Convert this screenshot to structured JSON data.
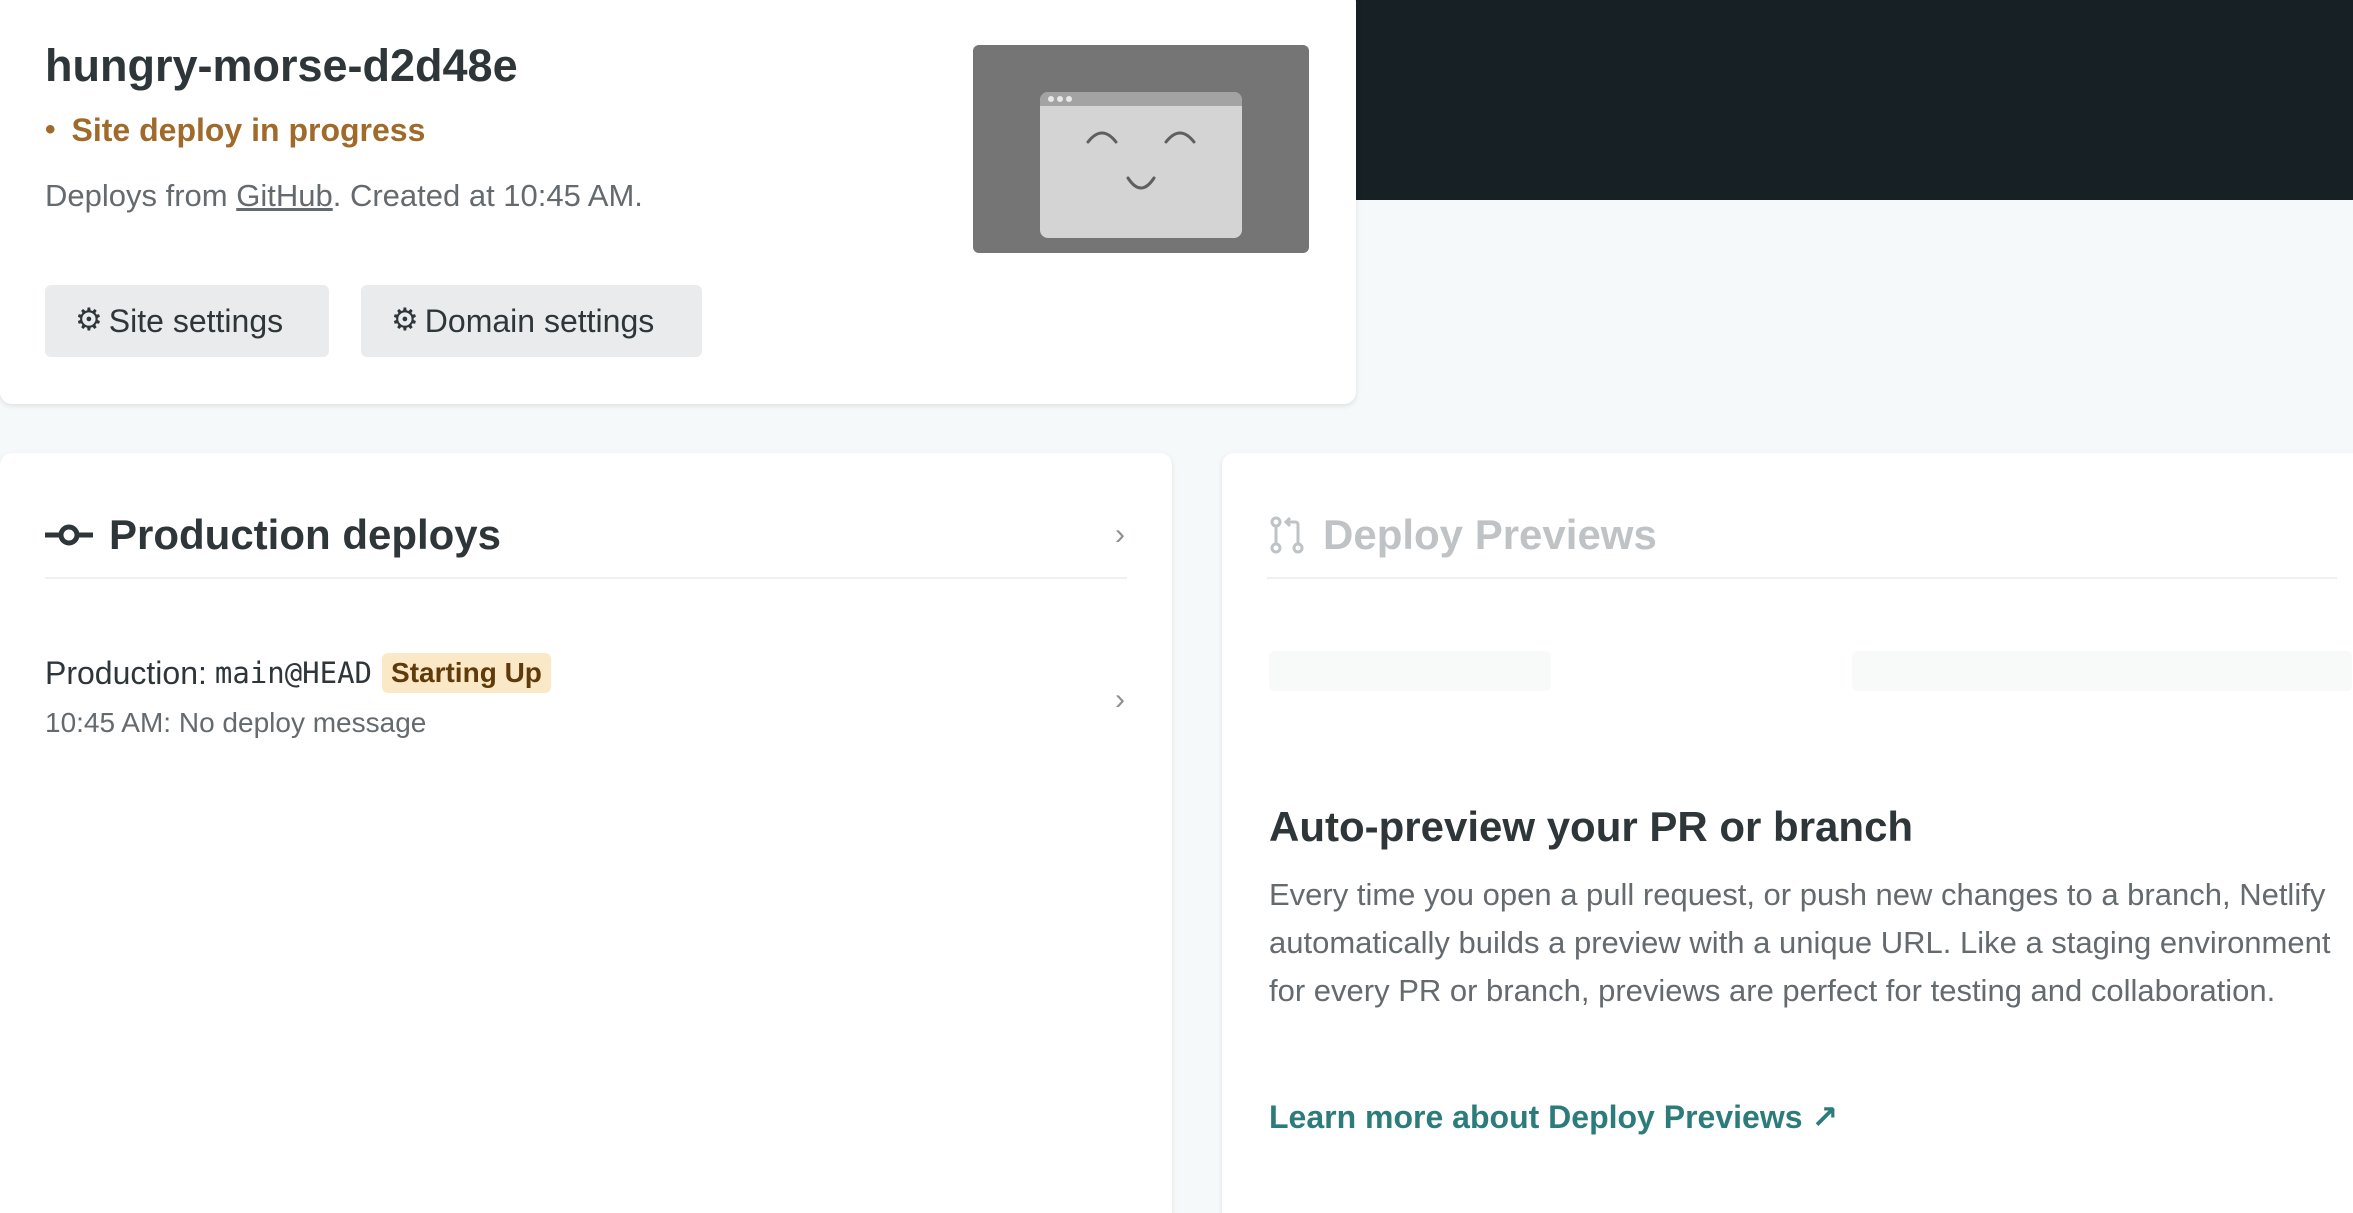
{
  "site": {
    "name": "hungry-morse-d2d48e",
    "status_dot": "•",
    "status": "Site deploy in progress",
    "source_prefix": "Deploys from ",
    "source_link": "GitHub",
    "source_suffix": ". Created at 10:45 AM.",
    "buttons": {
      "site_settings": "Site settings",
      "domain_settings": "Domain settings"
    }
  },
  "production": {
    "title": "Production deploys",
    "deploy": {
      "label": "Production:",
      "ref": "main@HEAD",
      "badge": "Starting Up",
      "message": "10:45 AM: No deploy message"
    }
  },
  "previews": {
    "title": "Deploy Previews",
    "heading": "Auto-preview your PR or branch",
    "description": "Every time you open a pull request, or push new changes to a branch, Netlify automatically builds a preview with a unique URL. Like a staging environment for every PR or branch, previews are perfect for testing and collaboration.",
    "link": "Learn more about Deploy Previews ↗"
  },
  "colors": {
    "accent": "#2d7c7c",
    "status": "#a06b2a",
    "badge_bg": "#fbe8c6",
    "dark_banner": "#172125"
  }
}
